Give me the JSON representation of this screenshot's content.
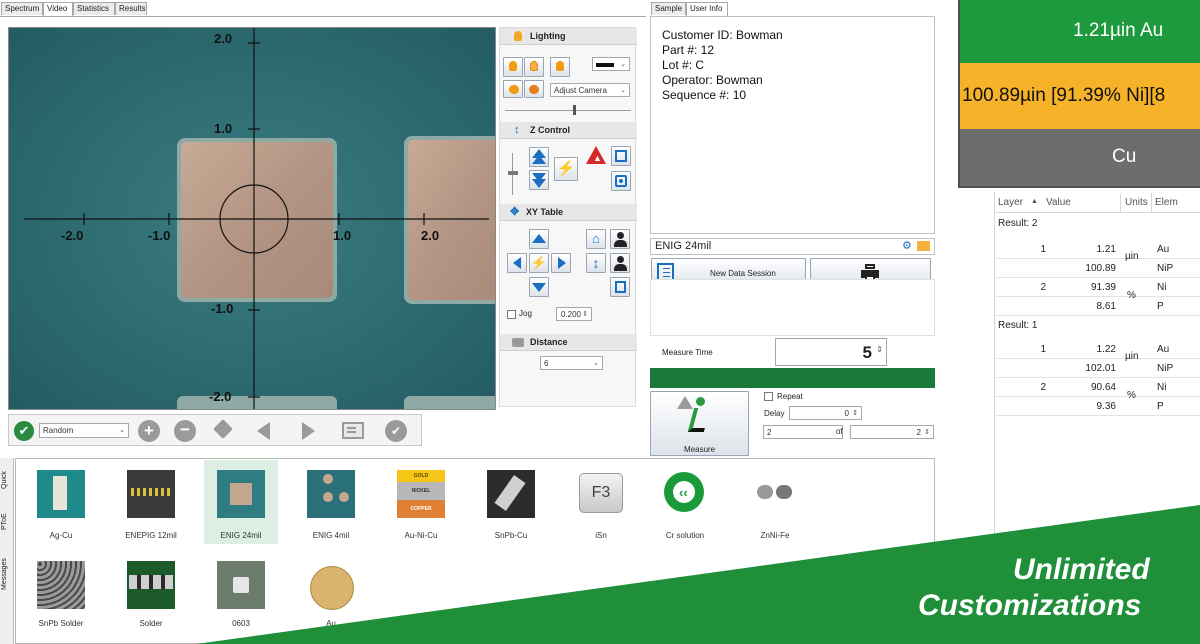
{
  "tabs": {
    "main": [
      "Spectrum",
      "Video",
      "Statistics",
      "Results"
    ],
    "info": [
      "Sample",
      "User Info"
    ]
  },
  "video": {
    "axis_labels": {
      "y_top": "2.0",
      "y_upper": "1.0",
      "y_lower": "-1.0",
      "y_bottom": "-2.0",
      "x_far_left": "-2.0",
      "x_left": "-1.0",
      "x_right": "1.0",
      "x_far_right": "2.0"
    }
  },
  "bottom_toolbar": {
    "pattern_select": "Random"
  },
  "lighting": {
    "title": "Lighting",
    "camera_select": "Adjust Camera"
  },
  "zcontrol": {
    "title": "Z Control"
  },
  "xytable": {
    "title": "XY Table",
    "jog_label": "Jog",
    "jog_value": "0.200"
  },
  "distance": {
    "title": "Distance",
    "value": "6"
  },
  "user_info": {
    "lines": [
      "Customer ID: Bowman",
      "Part #: 12",
      "Lot #: C",
      "Operator: Bowman",
      "Sequence #: 10"
    ]
  },
  "application": {
    "name": "ENIG 24mil",
    "new_session_label": "New Data Session"
  },
  "measure": {
    "time_label": "Measure Time",
    "time_value": "5",
    "button_label": "Measure",
    "repeat_label": "Repeat",
    "delay_label": "Delay",
    "delay_value": "0",
    "count_value": "2",
    "of_label": "of",
    "of_value": "2",
    "progress": 1.0
  },
  "layers": {
    "top": "1.21µin Au",
    "middle": "100.89µin [91.39% Ni][8",
    "bottom": "Cu"
  },
  "results_table": {
    "headers": [
      "Layer",
      "Value",
      "Units",
      "Elem"
    ],
    "groups": [
      {
        "label": "Result: 2",
        "rows": [
          {
            "layer": "1",
            "value": "1.21",
            "units": "µin",
            "elem": "Au"
          },
          {
            "layer": "",
            "value": "100.89",
            "units": "",
            "elem": "NiP"
          },
          {
            "layer": "2",
            "value": "91.39",
            "units": "%",
            "elem": "Ni"
          },
          {
            "layer": "",
            "value": "8.61",
            "units": "",
            "elem": "P"
          }
        ]
      },
      {
        "label": "Result: 1",
        "rows": [
          {
            "layer": "1",
            "value": "1.22",
            "units": "µin",
            "elem": "Au"
          },
          {
            "layer": "",
            "value": "102.01",
            "units": "",
            "elem": "NiP"
          },
          {
            "layer": "2",
            "value": "90.64",
            "units": "%",
            "elem": "Ni"
          },
          {
            "layer": "",
            "value": "9.36",
            "units": "",
            "elem": "P"
          }
        ]
      }
    ]
  },
  "side_tabs": [
    "Quick",
    "PToE",
    "Messages"
  ],
  "library": {
    "row1": [
      "Ag-Cu",
      "ENEPIG 12mil",
      "ENIG 24mil",
      "ENIG 4mil",
      "Au-Ni-Cu",
      "SnPb-Cu",
      "iSn",
      "Cr solution",
      "ZnNi-Fe"
    ],
    "row2": [
      "SnPb Solder",
      "Solder",
      "0603",
      "Au"
    ],
    "f3_key": "F3",
    "aunicu_thumb": [
      "GOLD",
      "NICKEL",
      "COPPER"
    ]
  },
  "banner": {
    "line1": "Unlimited",
    "line2": "Customizations"
  },
  "colors": {
    "au_layer": "#1e9a3e",
    "ni_layer": "#f6b228",
    "cu_layer": "#6d6d6d",
    "banner_green": "#1f8f3a",
    "progress_green": "#1a7a3a"
  }
}
